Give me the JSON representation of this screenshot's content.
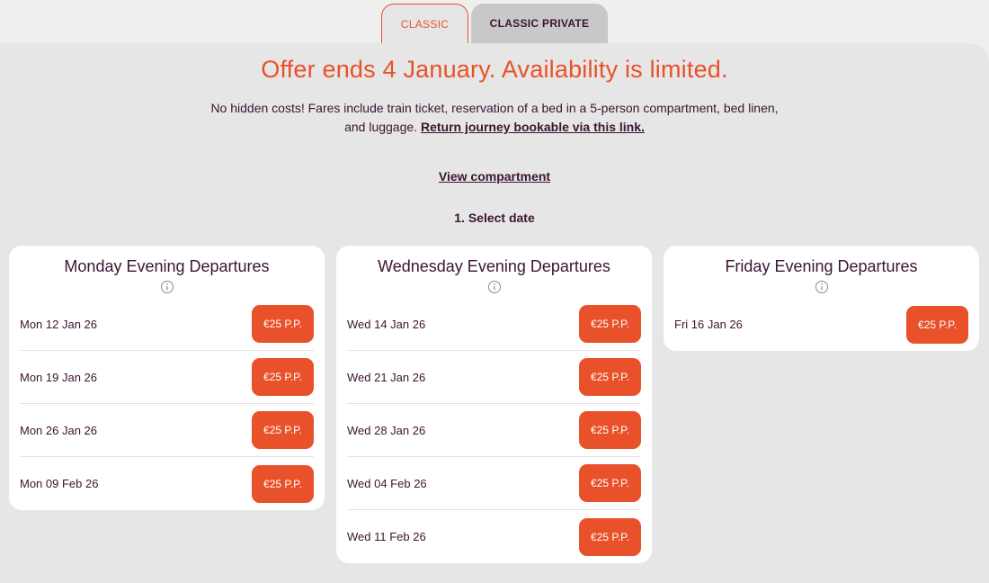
{
  "tabs": [
    {
      "label": "CLASSIC",
      "active": true
    },
    {
      "label": "CLASSIC PRIVATE",
      "active": false
    }
  ],
  "offer": {
    "headline": "Offer ends 4 January. Availability is limited.",
    "description": "No hidden costs! Fares include train ticket, reservation of a bed in a 5-person compartment, bed linen, and luggage.",
    "return_link": "Return journey bookable via this link."
  },
  "view_compartment": "View compartment",
  "select_date_heading": "1. Select date",
  "colors": {
    "accent": "#e8512a",
    "text": "#3b1530",
    "panel_bg": "#e6e6e6",
    "card_bg": "#ffffff"
  },
  "cards": [
    {
      "title": "Monday Evening Departures",
      "info_icon": "info-circle-icon",
      "rows": [
        {
          "date": "Mon 12 Jan 26",
          "price": "€25 P.P."
        },
        {
          "date": "Mon 19 Jan 26",
          "price": "€25 P.P."
        },
        {
          "date": "Mon 26 Jan 26",
          "price": "€25 P.P."
        },
        {
          "date": "Mon 09 Feb 26",
          "price": "€25 P.P."
        }
      ]
    },
    {
      "title": "Wednesday Evening Departures",
      "info_icon": "info-circle-icon",
      "rows": [
        {
          "date": "Wed 14 Jan 26",
          "price": "€25 P.P."
        },
        {
          "date": "Wed 21 Jan 26",
          "price": "€25 P.P."
        },
        {
          "date": "Wed 28 Jan 26",
          "price": "€25 P.P."
        },
        {
          "date": "Wed 04 Feb 26",
          "price": "€25 P.P."
        },
        {
          "date": "Wed 11 Feb 26",
          "price": "€25 P.P."
        }
      ]
    },
    {
      "title": "Friday Evening Departures",
      "info_icon": "info-circle-icon",
      "rows": [
        {
          "date": "Fri 16 Jan 26",
          "price": "€25 P.P."
        }
      ]
    }
  ]
}
